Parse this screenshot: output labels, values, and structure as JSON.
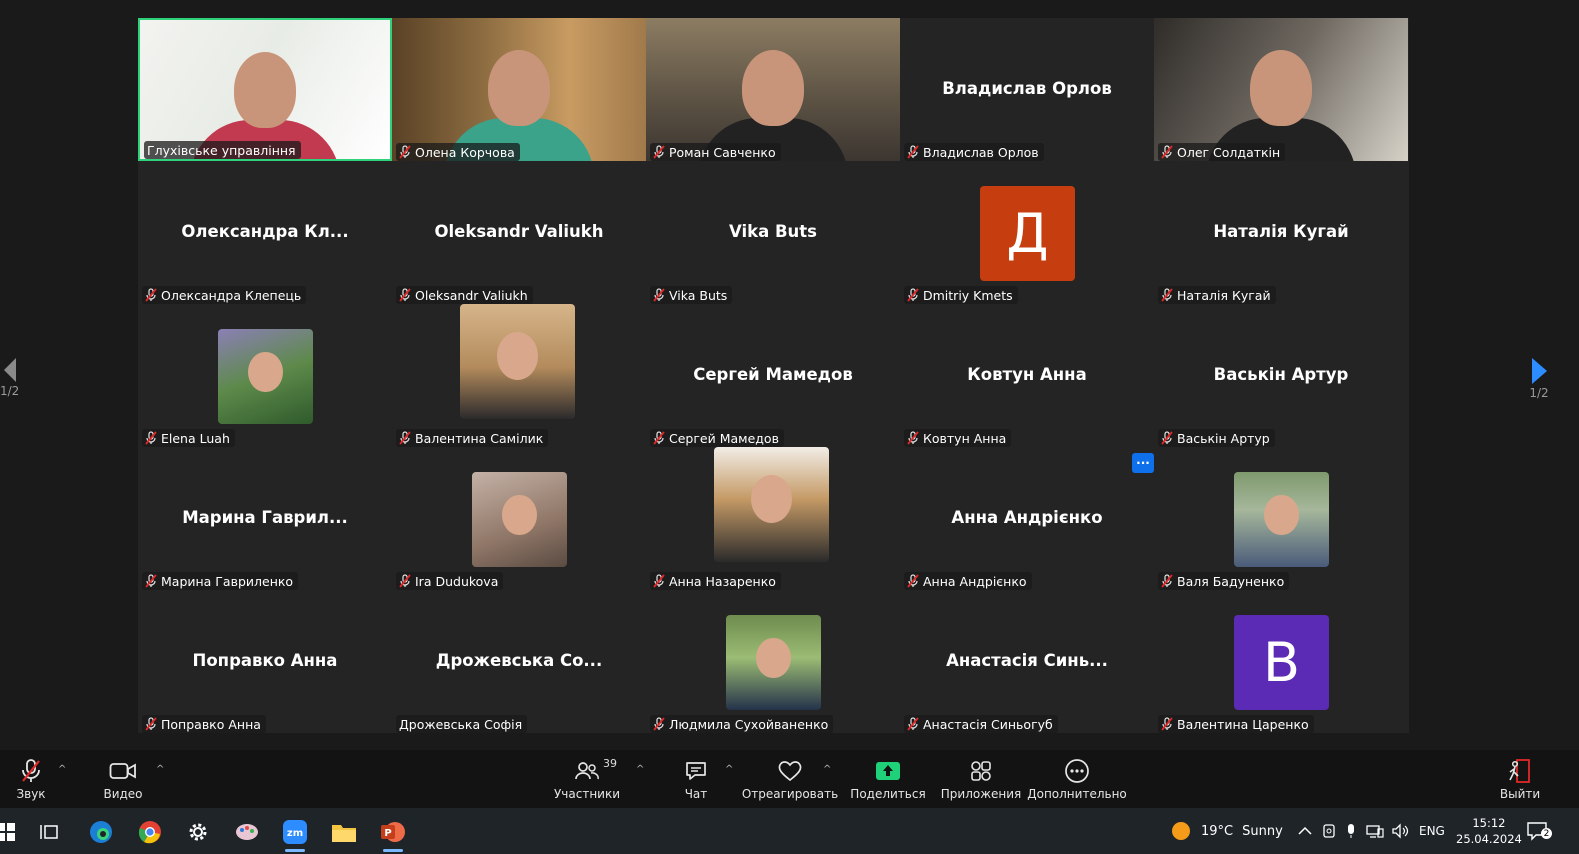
{
  "gallery": {
    "tiles": [
      {
        "name": "Глухівське управління",
        "kind": "video",
        "active": true,
        "muted": false
      },
      {
        "name": "Олена Корчова",
        "kind": "video",
        "muted": true
      },
      {
        "name": "Роман Савченко",
        "kind": "video",
        "muted": true
      },
      {
        "name": "Владислав Орлов",
        "display": "Владислав Орлов",
        "kind": "name",
        "muted": true
      },
      {
        "name": "Олег Солдаткін",
        "kind": "video",
        "muted": true
      },
      {
        "name": "Олександра Клепець",
        "display": "Олександра  Кл...",
        "kind": "name",
        "muted": true
      },
      {
        "name": "Oleksandr Valiukh",
        "display": "Oleksandr Valiukh",
        "kind": "name",
        "muted": true
      },
      {
        "name": "Vika Buts",
        "display": "Vika Buts",
        "kind": "name",
        "muted": true
      },
      {
        "name": "Dmitriy Kmets",
        "letter": "Д",
        "kind": "letter",
        "color": "#c63d0f",
        "muted": true
      },
      {
        "name": "Наталія Кугай",
        "display": "Наталія Кугай",
        "kind": "name",
        "muted": true
      },
      {
        "name": "Elena Luah",
        "kind": "photo",
        "muted": true
      },
      {
        "name": "Валентина Самілик",
        "kind": "photo-big",
        "muted": true
      },
      {
        "name": "Сергей Мамедов",
        "display": "Сергей Мамедов",
        "kind": "name",
        "muted": true
      },
      {
        "name": "Ковтун Анна",
        "display": "Ковтун Анна",
        "kind": "name",
        "muted": true
      },
      {
        "name": "Васькін Артур",
        "display": "Васькін Артур",
        "kind": "name",
        "muted": true
      },
      {
        "name": "Марина Гавриленко",
        "display": "Марина  Гаврил...",
        "kind": "name",
        "muted": true
      },
      {
        "name": "Ira Dudukova",
        "kind": "photo",
        "muted": true
      },
      {
        "name": "Анна Назаренко",
        "kind": "photo-big",
        "muted": true
      },
      {
        "name": "Анна Андрієнко",
        "display": "Анна Андрієнко",
        "kind": "name",
        "muted": true
      },
      {
        "name": "Валя Бадуненко",
        "kind": "photo",
        "muted": true
      },
      {
        "name": "Поправко Анна",
        "display": "Поправко Анна",
        "kind": "name",
        "muted": true
      },
      {
        "name": "Дрожевська Софія",
        "display": "Дрожевська  Со...",
        "kind": "name",
        "muted": false
      },
      {
        "name": "Людмила Сухойваненко",
        "kind": "photo",
        "muted": true
      },
      {
        "name": "Анастасія Синьогуб",
        "display": "Анастасія  Синь...",
        "kind": "name",
        "muted": true
      },
      {
        "name": "Валентина Царенко",
        "letter": "В",
        "kind": "letter",
        "color": "#5b2bb5",
        "muted": true
      }
    ],
    "page_left": "1/2",
    "page_right": "1/2",
    "more_label": "···"
  },
  "toolbar": {
    "audio": "Звук",
    "video": "Видео",
    "participants": "Участники",
    "participants_count": "39",
    "chat": "Чат",
    "react": "Отреагировать",
    "share": "Поделиться",
    "apps": "Приложения",
    "more": "Дополнительно",
    "leave": "Выйти"
  },
  "taskbar": {
    "weather_temp": "19°C",
    "weather_desc": "Sunny",
    "lang": "ENG",
    "time": "15:12",
    "date": "25.04.2024",
    "notif_count": "2"
  },
  "colors": {
    "active_border": "#2ed27b",
    "more_button": "#0e71eb",
    "share_icon": "#1fd27a",
    "mute_red": "#e02828",
    "leave_red": "#e02828"
  }
}
